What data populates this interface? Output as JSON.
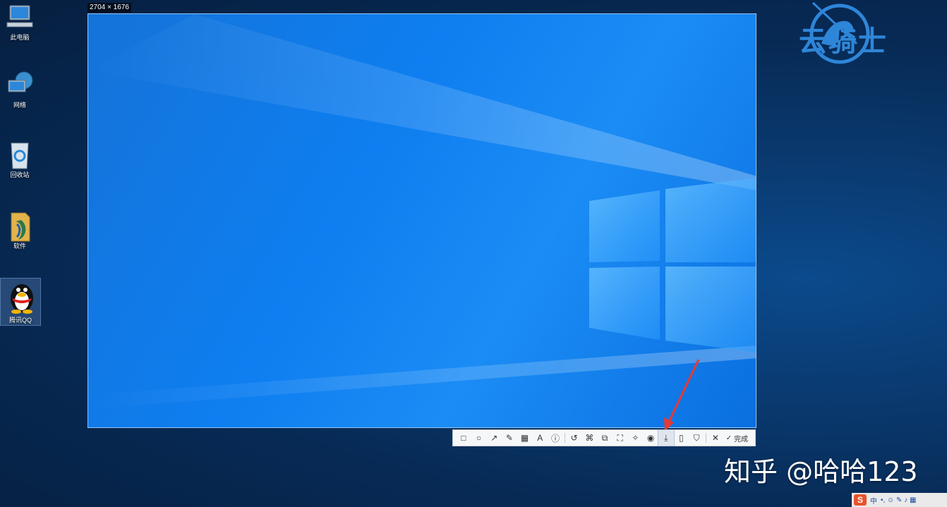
{
  "desktop": {
    "icons": [
      {
        "label": "此电脑",
        "icon": "computer-icon"
      },
      {
        "label": "网络",
        "icon": "network-icon"
      },
      {
        "label": "回收站",
        "icon": "recycle-bin-icon"
      },
      {
        "label": "软件",
        "icon": "folder-icon"
      },
      {
        "label": "腾讯QQ",
        "icon": "qq-penguin-icon"
      }
    ]
  },
  "capture": {
    "size_label": "2704 × 1676"
  },
  "toolbar": {
    "tools": [
      {
        "name": "rectangle",
        "icon": "rectangle-icon",
        "glyph": "□"
      },
      {
        "name": "ellipse",
        "icon": "ellipse-icon",
        "glyph": "○"
      },
      {
        "name": "arrow",
        "icon": "arrow-icon",
        "glyph": "↗"
      },
      {
        "name": "pen",
        "icon": "pencil-icon",
        "glyph": "✎"
      },
      {
        "name": "mosaic",
        "icon": "mosaic-icon",
        "glyph": "▦"
      },
      {
        "name": "text",
        "icon": "text-icon",
        "glyph": "A"
      },
      {
        "name": "number",
        "icon": "number-icon",
        "glyph": "ⓘ"
      },
      {
        "name": "undo",
        "icon": "undo-icon",
        "glyph": "↺"
      },
      {
        "name": "ocr",
        "icon": "ocr-icon",
        "glyph": "⌘"
      },
      {
        "name": "translate",
        "icon": "translate-icon",
        "glyph": "⧉"
      },
      {
        "name": "scroll-capture",
        "icon": "scroll-capture-icon",
        "glyph": "⛶"
      },
      {
        "name": "pin",
        "icon": "pin-icon",
        "glyph": "✧"
      },
      {
        "name": "record",
        "icon": "record-icon",
        "glyph": "◉"
      },
      {
        "name": "save",
        "icon": "download-icon",
        "glyph": "⤓"
      },
      {
        "name": "phone",
        "icon": "phone-icon",
        "glyph": "▯"
      },
      {
        "name": "bookmark",
        "icon": "bookmark-icon",
        "glyph": "⛉"
      }
    ],
    "close_glyph": "✕",
    "done_glyph": "✓",
    "done_label": "完成",
    "active_tool": "save"
  },
  "watermarks": {
    "brand": "云骑士",
    "zhihu": "知乎 @哈哈123"
  },
  "ime": {
    "logo": "S",
    "mode": "中",
    "glyphs": "•, ☺ ✎ ♪ ▦"
  },
  "colors": {
    "annotation_arrow": "#e53935",
    "brand_blue": "#2e86d8"
  }
}
